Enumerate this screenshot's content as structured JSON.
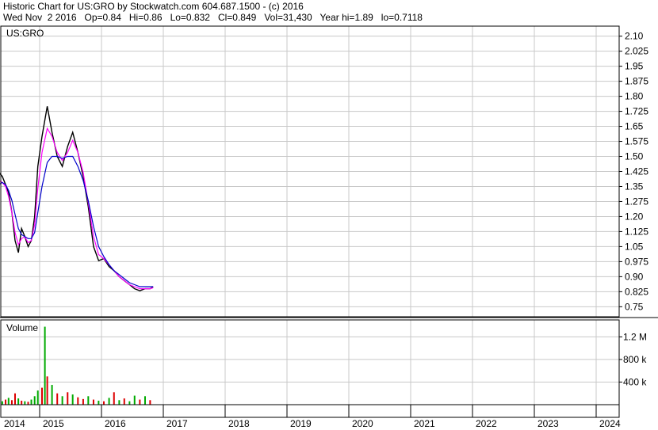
{
  "header": {
    "line1": "Historic Chart for US:GRO by Stockwatch.com 604.687.1500 - (c) 2016",
    "line2": "Wed Nov  2 2016   Op=0.84   Hi=0.86   Lo=0.832   Cl=0.849   Vol=31,430   Year hi=1.89   lo=0.7118"
  },
  "chart_data": {
    "type": "line",
    "symbol_label": "US:GRO",
    "volume_label": "Volume",
    "price_ticks": [
      "2.10",
      "2.025",
      "1.95",
      "1.875",
      "1.80",
      "1.725",
      "1.65",
      "1.575",
      "1.50",
      "1.425",
      "1.35",
      "1.275",
      "1.20",
      "1.125",
      "1.05",
      "0.975",
      "0.90",
      "0.825",
      "0.75"
    ],
    "volume_ticks": [
      "1.2 M",
      "800 k",
      "400 k"
    ],
    "year_labels": [
      "2014",
      "2015",
      "2016",
      "2017",
      "2018",
      "2019",
      "2020",
      "2021",
      "2022",
      "2023",
      "2024"
    ],
    "price_range": [
      0.7,
      2.15
    ],
    "volume_range": [
      0,
      1500000
    ],
    "colors": {
      "price": "#000000",
      "ma_short": "#ff00ff",
      "ma_long": "#0000cc",
      "vol_up": "#00aa00",
      "vol_down": "#dd0000"
    },
    "price_series": {
      "x": [
        "2013-12-15",
        "2014-01-15",
        "2014-02-15",
        "2014-03-15",
        "2014-04-15",
        "2014-05-15",
        "2014-06-15",
        "2014-07-15",
        "2014-08-15",
        "2014-09-15",
        "2014-10-15",
        "2014-11-15",
        "2014-12-15",
        "2015-01-15",
        "2015-02-15",
        "2015-03-15",
        "2015-04-15",
        "2015-05-15",
        "2015-06-15",
        "2015-07-15",
        "2015-08-15",
        "2015-09-15",
        "2015-10-15",
        "2015-11-15",
        "2015-12-15",
        "2016-01-15",
        "2016-02-15",
        "2016-03-15",
        "2016-04-15",
        "2016-05-15",
        "2016-06-15",
        "2016-07-15",
        "2016-08-15",
        "2016-09-15",
        "2016-10-15",
        "2016-11-02"
      ],
      "close": [
        1.42,
        1.4,
        1.36,
        1.32,
        1.22,
        1.08,
        1.02,
        1.14,
        1.1,
        1.05,
        1.08,
        1.2,
        1.45,
        1.6,
        1.75,
        1.62,
        1.5,
        1.45,
        1.55,
        1.62,
        1.52,
        1.4,
        1.25,
        1.05,
        0.98,
        0.99,
        0.95,
        0.93,
        0.9,
        0.88,
        0.86,
        0.84,
        0.83,
        0.84,
        0.84,
        0.849
      ]
    },
    "ma_short": [
      1.38,
      1.37,
      1.35,
      1.3,
      1.22,
      1.12,
      1.06,
      1.09,
      1.1,
      1.07,
      1.08,
      1.16,
      1.34,
      1.52,
      1.64,
      1.6,
      1.52,
      1.48,
      1.52,
      1.58,
      1.52,
      1.42,
      1.27,
      1.1,
      1.01,
      0.99,
      0.96,
      0.93,
      0.9,
      0.88,
      0.86,
      0.85,
      0.84,
      0.84,
      0.84,
      0.845
    ],
    "ma_long": [
      1.36,
      1.37,
      1.36,
      1.33,
      1.28,
      1.21,
      1.14,
      1.11,
      1.1,
      1.09,
      1.09,
      1.12,
      1.22,
      1.35,
      1.47,
      1.5,
      1.5,
      1.49,
      1.5,
      1.5,
      1.45,
      1.38,
      1.28,
      1.15,
      1.05,
      1.0,
      0.96,
      0.93,
      0.91,
      0.89,
      0.87,
      0.86,
      0.85,
      0.85,
      0.85,
      0.85
    ],
    "volume": {
      "x": [
        "2014-01-15",
        "2014-02-15",
        "2014-03-15",
        "2014-04-15",
        "2014-05-15",
        "2014-06-15",
        "2014-07-15",
        "2014-08-15",
        "2014-09-15",
        "2014-10-15",
        "2014-11-15",
        "2014-12-15",
        "2015-01-15",
        "2015-02-01",
        "2015-02-15",
        "2015-03-15",
        "2015-04-15",
        "2015-05-15",
        "2015-06-15",
        "2015-07-15",
        "2015-08-15",
        "2015-09-15",
        "2015-10-15",
        "2015-11-15",
        "2015-12-15",
        "2016-01-15",
        "2016-02-15",
        "2016-03-15",
        "2016-04-15",
        "2016-05-15",
        "2016-06-15",
        "2016-07-15",
        "2016-08-15",
        "2016-09-15",
        "2016-10-15"
      ],
      "values": [
        60000,
        90000,
        120000,
        80000,
        200000,
        110000,
        70000,
        60000,
        50000,
        90000,
        150000,
        250000,
        300000,
        1380000,
        500000,
        350000,
        200000,
        150000,
        220000,
        180000,
        130000,
        100000,
        150000,
        90000,
        70000,
        60000,
        120000,
        220000,
        80000,
        110000,
        60000,
        160000,
        90000,
        150000,
        80000
      ],
      "up": [
        true,
        false,
        true,
        false,
        false,
        true,
        false,
        true,
        false,
        true,
        true,
        true,
        false,
        true,
        false,
        true,
        false,
        true,
        false,
        true,
        false,
        false,
        true,
        false,
        true,
        false,
        true,
        false,
        true,
        false,
        true,
        true,
        false,
        true,
        false
      ]
    }
  }
}
